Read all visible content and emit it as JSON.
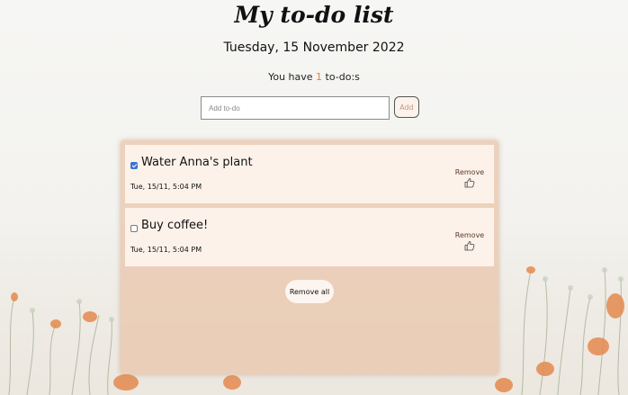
{
  "header": {
    "title": "My to-do list",
    "date": "Tuesday, 15 November 2022",
    "count_prefix": "You have",
    "count_value": "1",
    "count_suffix": "to-do:s"
  },
  "form": {
    "input_placeholder": "Add to-do",
    "input_value": "",
    "add_label": "Add"
  },
  "todos": [
    {
      "text": "Water Anna's plant",
      "timestamp": "Tue, 15/11, 5:04 PM",
      "done": true,
      "remove_label": "Remove",
      "icon": "thumbs-up-icon"
    },
    {
      "text": "Buy coffee!",
      "timestamp": "Tue, 15/11, 5:04 PM",
      "done": false,
      "remove_label": "Remove",
      "icon": "thumbs-up-icon"
    }
  ],
  "remove_all_label": "Remove all",
  "colors": {
    "accent": "#e0843a",
    "panel": "#e9c4a8",
    "item": "#fdf2ea",
    "checkbox": "#3b73d1"
  }
}
